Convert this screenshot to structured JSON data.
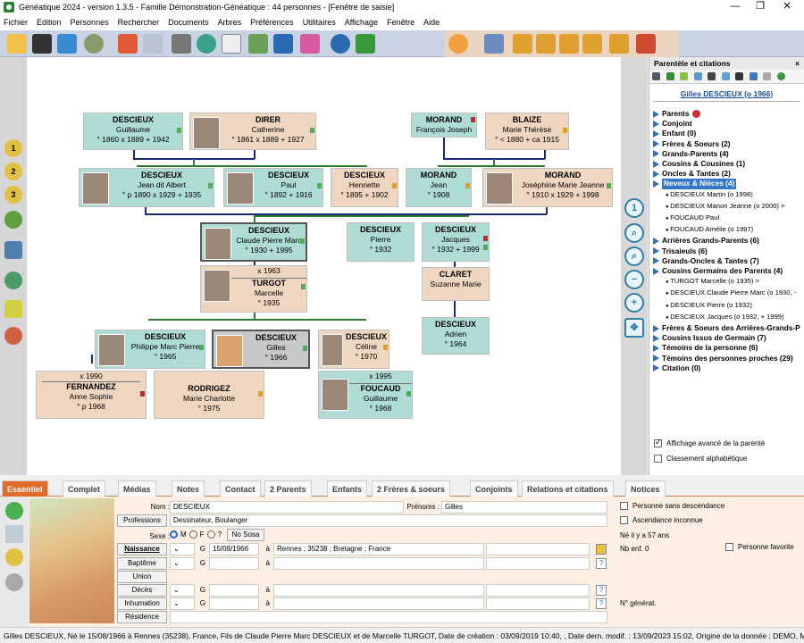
{
  "window": {
    "title": "Généatique 2024 - version 1.3.5 - Famille Démonstration-Généatique : 44 personnes - [Fenêtre de saisie]",
    "minimize": "—",
    "maximize": "❐",
    "close": "✕"
  },
  "menu": [
    "Fichier",
    "Edition",
    "Personnes",
    "Rechercher",
    "Documents",
    "Arbres",
    "Préférences",
    "Utilitaires",
    "Affichage",
    "Fenêtre",
    "Aide"
  ],
  "left_tools": [
    "1",
    "2",
    "3"
  ],
  "cards": {
    "guillaume": {
      "name": "DESCIEUX",
      "given": "Guillaume",
      "dates": "° 1860   x 1889   + 1942"
    },
    "catherine": {
      "name": "DIRER",
      "given": "Catherine",
      "dates": "° 1861   x 1889   + 1927"
    },
    "francois": {
      "name": "MORAND",
      "given": "François Joseph"
    },
    "therese": {
      "name": "BLAIZE",
      "given": "Marie Thérèse",
      "dates": "° < 1880   + ca 1915"
    },
    "albert": {
      "name": "DESCIEUX",
      "given": "Jean dit Albert",
      "dates": "° p 1890   x 1929   + 1935"
    },
    "paul": {
      "name": "DESCIEUX",
      "given": "Paul",
      "dates": "° 1892   + 1916"
    },
    "henriette": {
      "name": "DESCIEUX",
      "given": "Henriette",
      "dates": "° 1895   + 1902"
    },
    "jean": {
      "name": "MORAND",
      "given": "Jean",
      "dates": "° 1908"
    },
    "josephine": {
      "name": "MORAND",
      "given": "Joséphine Marie Jeanne",
      "dates": "° 1910   x 1929   + 1998"
    },
    "claude": {
      "name": "DESCIEUX",
      "given": "Claude Pierre Marc",
      "dates": "° 1930   + 1995"
    },
    "pierre": {
      "name": "DESCIEUX",
      "given": "Pierre",
      "dates": "° 1932"
    },
    "jacques": {
      "name": "DESCIEUX",
      "given": "Jacques",
      "dates": "° 1932   + 1999"
    },
    "marcelle": {
      "marriage": "x 1963",
      "name": "TURGOT",
      "given": "Marcelle",
      "dates": "° 1935"
    },
    "suzanne": {
      "name": "CLARET",
      "given": "Suzanne Marie"
    },
    "adrien": {
      "name": "DESCIEUX",
      "given": "Adrien",
      "dates": "° 1964"
    },
    "philippe": {
      "name": "DESCIEUX",
      "given": "Philippe Marc Pierre",
      "dates": "° 1965"
    },
    "gilles": {
      "name": "DESCIEUX",
      "given": "Gilles",
      "dates": "° 1966"
    },
    "celine": {
      "name": "DESCIEUX",
      "given": "Céline",
      "dates": "° 1970"
    },
    "anne": {
      "marriage": "x 1990",
      "name": "FERNANDEZ",
      "given": "Anne Sophie",
      "dates": "° p 1968"
    },
    "rodrigez": {
      "name": "RODRIGEZ",
      "given": "Marie Charlotte",
      "dates": "° 1975"
    },
    "foucaud": {
      "marriage": "x 1995",
      "name": "FOUCAUD",
      "given": "Guillaume",
      "dates": "° 1968"
    }
  },
  "right_panel": {
    "title": "Parentèle et citations",
    "close": "×",
    "person": "Gilles DESCIEUX  (o  1966)",
    "items": [
      {
        "label": "Parents",
        "subs": []
      },
      {
        "label": "Conjoint",
        "subs": []
      },
      {
        "label": "Enfant (0)",
        "subs": []
      },
      {
        "label": "Frères & Soeurs (2)",
        "subs": []
      },
      {
        "label": "Grands-Parents (4)",
        "subs": []
      },
      {
        "label": "Cousins & Cousines (1)",
        "subs": []
      },
      {
        "label": "Oncles & Tantes (2)",
        "subs": []
      },
      {
        "label": "Neveux & Nièces (4)",
        "subs": [
          "DESCIEUX Martin  (o  1998)",
          "DESCIEUX Manon Jeanne  (o  2000)   >",
          "FOUCAUD Paul",
          "FOUCAUD Amélie  (o  1997)"
        ]
      },
      {
        "label": "Arrières Grands-Parents (6)",
        "subs": []
      },
      {
        "label": "Trisaieuls (6)",
        "subs": []
      },
      {
        "label": "Grands-Oncles & Tantes (7)",
        "subs": []
      },
      {
        "label": "Cousins Germains des Parents (4)",
        "subs": [
          "TURGOT Marcelle  (o  1935)   >",
          "DESCIEUX Claude Pierre Marc  (o  1930,  -",
          "DESCIEUX Pierre  (o  1932)",
          "DESCIEUX Jacques  (o  1932,  + 1999)"
        ]
      },
      {
        "label": "Frères & Soeurs des Arrières-Grands-P",
        "subs": []
      },
      {
        "label": "Cousins Issus de Germain (7)",
        "subs": []
      },
      {
        "label": "Témoins de la personne (6)",
        "subs": []
      },
      {
        "label": "Témoins des personnes proches (29)",
        "subs": []
      },
      {
        "label": "Citation (0)",
        "subs": []
      }
    ],
    "opt1": "Affichage avancé de la parenté",
    "opt2": "Classement alphabétique"
  },
  "tabs": [
    "Essentiel",
    "Complet",
    "Médias",
    "Notes",
    "Contact",
    "2 Parents",
    "Enfants",
    "2 Frères & soeurs",
    "Conjoints",
    "Relations et citations",
    "Notices"
  ],
  "form": {
    "nom_label": "Nom :",
    "nom": "DESCIEUX",
    "prenoms_label": "Prénoms :",
    "prenoms": "Gilles",
    "professions_btn": "Professions",
    "profession": "Dessinateur, Boulanger",
    "sexe_label": "Sexe :",
    "sexe_m": "M",
    "sexe_f": "F",
    "sexe_q": "?",
    "nososa": "No Sosa",
    "naissance_btn": "Naissance",
    "g": "G",
    "birth_date": "15/08/1966",
    "a": "à",
    "birth_place": "Rennes ; 35238 ; Bretagne ; France",
    "bapteme_btn": "Baptême",
    "union_btn": "Union",
    "deces_btn": "Décès",
    "inhumation_btn": "Inhumation",
    "residence_btn": "Résidence",
    "qm": "?",
    "sans_desc": "Personne sans descendance",
    "asc_inconnue": "Ascendance inconnue",
    "age": "Né il y a 57 ans",
    "nb_enf": "Nb enf. 0",
    "favorite": "Personne favorite",
    "generat": "N° générat."
  },
  "status": "Gilles DESCIEUX, Né le 15/08/1966 à Rennes (35238), France, Fils de Claude Pierre Marc DESCIEUX et de Marcelle TURGOT, Date de création : 03/09/2019 10:40, , Date dern. modif. : 13/09/2023 15:02, Origine de la donnée : DEMO, Mobilité en KM :"
}
